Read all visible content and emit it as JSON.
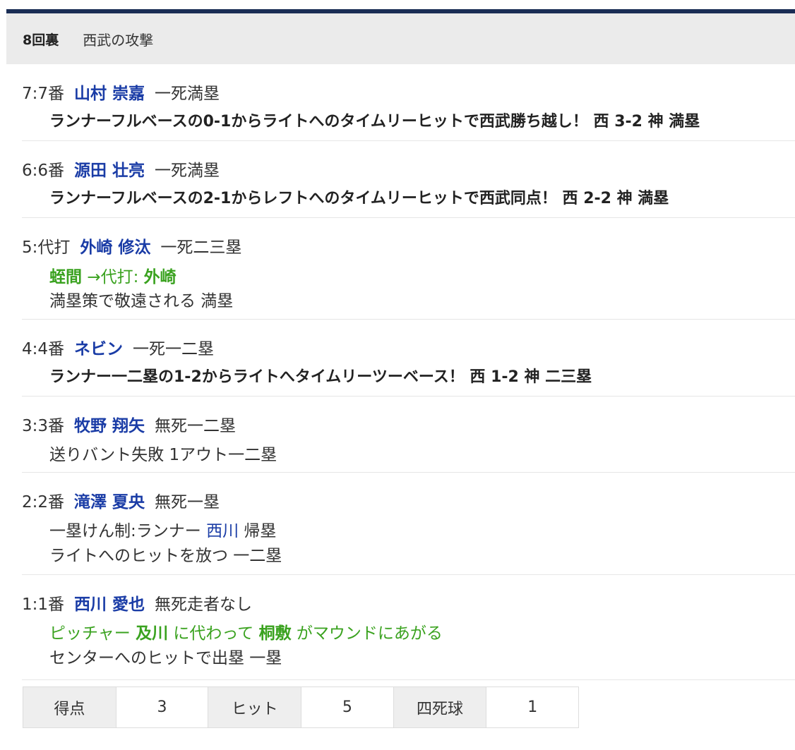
{
  "header": {
    "inning": "8回裏",
    "team_attack": "西武の攻撃"
  },
  "plays": [
    {
      "num": "7",
      "order": "7番",
      "batter": "山村 崇嘉",
      "situation": "一死満塁",
      "lines": [
        {
          "style": "bold",
          "text": "ランナーフルベースの0-1からライトへのタイムリーヒットで西武勝ち越し！ 西 3-2 神 満塁"
        }
      ]
    },
    {
      "num": "6",
      "order": "6番",
      "batter": "源田 壮亮",
      "situation": "一死満塁",
      "lines": [
        {
          "style": "bold",
          "text": "ランナーフルベースの2-1からレフトへのタイムリーヒットで西武同点！ 西 2-2 神 満塁"
        }
      ]
    },
    {
      "num": "5",
      "order": "代打",
      "batter": "外崎 修汰",
      "situation": "一死二三塁",
      "lines": [
        {
          "style": "sub",
          "from": "蛭間",
          "arrow": "→代打: ",
          "to": "外崎"
        },
        {
          "style": "normal",
          "text": "満塁策で敬遠される 満塁"
        }
      ]
    },
    {
      "num": "4",
      "order": "4番",
      "batter": "ネビン",
      "situation": "一死一二塁",
      "lines": [
        {
          "style": "bold",
          "text": "ランナー一二塁の1-2からライトへタイムリーツーベース！ 西 1-2 神 二三塁"
        }
      ]
    },
    {
      "num": "3",
      "order": "3番",
      "batter": "牧野 翔矢",
      "situation": "無死一二塁",
      "lines": [
        {
          "style": "normal",
          "text": "送りバント失敗 1アウト一二塁"
        }
      ]
    },
    {
      "num": "2",
      "order": "2番",
      "batter": "滝澤 夏央",
      "situation": "無死一塁",
      "lines": [
        {
          "style": "runner",
          "prefix": "一塁けん制:ランナー ",
          "runner": "西川",
          "suffix": " 帰塁"
        },
        {
          "style": "normal",
          "text": "ライトへのヒットを放つ 一二塁"
        }
      ]
    },
    {
      "num": "1",
      "order": "1番",
      "batter": "西川 愛也",
      "situation": "無死走者なし",
      "lines": [
        {
          "style": "pitcher",
          "p1": "ピッチャー ",
          "old": "及川",
          "p2": " に代わって ",
          "new": "桐敷",
          "p3": " がマウンドにあがる"
        },
        {
          "style": "normal",
          "text": "センターへのヒットで出塁 一塁"
        }
      ]
    }
  ],
  "stats": [
    {
      "label": "得点",
      "value": "3"
    },
    {
      "label": "ヒット",
      "value": "5"
    },
    {
      "label": "四死球",
      "value": "1"
    }
  ],
  "colors": {
    "topbar": "#1a2d55",
    "player_link": "#1a3ca6",
    "change_green": "#3aa21f",
    "header_bg": "#ebebeb"
  }
}
